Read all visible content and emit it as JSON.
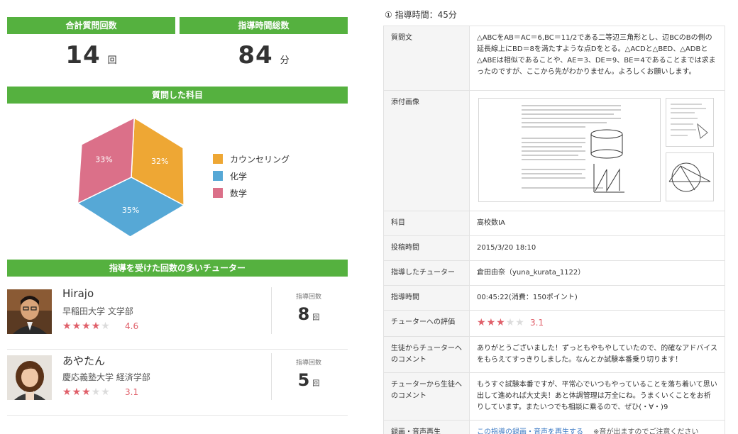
{
  "summary": {
    "total_questions_label": "合計質問回数",
    "total_questions_value": "14",
    "total_questions_unit": "回",
    "total_minutes_label": "指導時間総数",
    "total_minutes_value": "84",
    "total_minutes_unit": "分"
  },
  "subjects": {
    "title": "質問した科目",
    "legend": [
      "カウンセリング",
      "化学",
      "数学"
    ]
  },
  "chart_data": {
    "type": "pie",
    "categories": [
      "カウンセリング",
      "化学",
      "数学"
    ],
    "values": [
      32,
      35,
      33
    ],
    "labels": [
      "32%",
      "35%",
      "33%"
    ],
    "colors": [
      "#eea734",
      "#56a8d6",
      "#db7089"
    ],
    "legend_position": "right"
  },
  "tutors": {
    "title": "指導を受けた回数の多いチューター",
    "count_label": "指導回数",
    "count_unit": "回",
    "items": [
      {
        "name": "Hirajo",
        "school": "早稲田大学 文学部",
        "rating": "4.6",
        "stars": 4,
        "count": "8"
      },
      {
        "name": "あやたん",
        "school": "慶応義塾大学 経済学部",
        "rating": "3.1",
        "stars": 3,
        "count": "5"
      }
    ]
  },
  "detail": {
    "section_title": "① 指導時間：45分",
    "question_label": "質問文",
    "question_text": "△ABCをAB＝AC＝6,BC＝11/2である二等辺三角形とし、辺BCのBの側の延長線上にBD＝8を満たすような点Dをとる。△ACDと△BED、△ADBと△ABEは相似であることや、AE＝3、DE＝9、BE＝4であることまでは求まったのですが、ここから先がわかりません。よろしくお願いします。",
    "attachment_label": "添付画像",
    "subject_label": "科目",
    "subject_value": "高校数ⅠA",
    "posted_label": "投稿時間",
    "posted_value": "2015/3/20 18:10",
    "tutor_label": "指導したチューター",
    "tutor_value": "倉田由奈（yuna_kurata_1122）",
    "time_label": "指導時間",
    "time_value": "00:45:22(消費：150ポイント)",
    "rating_label": "チューターへの評価",
    "rating_value": "3.1",
    "rating_stars": 3,
    "student_comment_label": "生徒からチューターへのコメント",
    "student_comment": "ありがとうございました！ずっともやもやしていたので、的確なアドバイスをもらえてすっきりしました。なんとか試験本番乗り切ります！",
    "tutor_comment_label": "チューターから生徒へのコメント",
    "tutor_comment": "もうすぐ試験本番ですが、平常心でいつもやっていることを落ち着いて思い出して進めれば大丈夫！あと体調管理は万全にね。うまくいくことをお祈りしています。またいつでも相談に乗るので、ぜひ(・∀・)9",
    "replay_label": "録画・音声再生",
    "replay_link": "この指導の録画・音声を再生する",
    "replay_note": "※音が出ますのでご注意ください"
  }
}
